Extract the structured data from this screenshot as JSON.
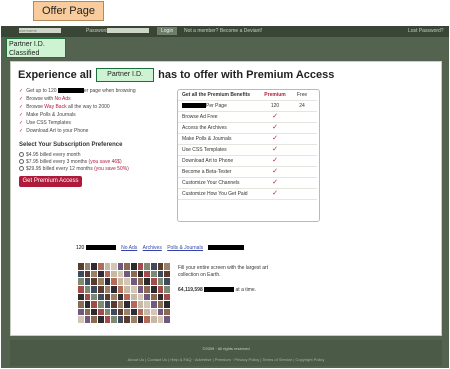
{
  "labels": {
    "offer": "Offer Page",
    "partner_classified": "Partner I.D. Classified",
    "partner_inline": "Partner I.D."
  },
  "topbar": {
    "username_placeholder": "username",
    "password_label": "Password",
    "login_button": "Login",
    "member_prompt": "Not a member? Become a Deviant!",
    "lost_password": "Lost Password?"
  },
  "headline": {
    "prefix": "Experience all",
    "suffix": "has to offer with Premium Access"
  },
  "features": [
    {
      "pre": "Get up to 120 ",
      "redact": true,
      "post": "er page when browsing"
    },
    {
      "pre": "Browse with ",
      "hl": "No Ads",
      "post": ""
    },
    {
      "pre": "Browse ",
      "hl": "Way Back",
      "post": " all the way to 2000"
    },
    {
      "pre": "Make Polls & Journals",
      "hl": "",
      "post": ""
    },
    {
      "pre": "Use CSS Templates",
      "hl": "",
      "post": ""
    },
    {
      "pre": "Download Art to your Phone",
      "hl": "",
      "post": ""
    }
  ],
  "subscription": {
    "title": "Select Your Subscription Preference",
    "options": [
      {
        "text": "$4.95 billed every month",
        "save": ""
      },
      {
        "text": "$7.95 billed every 3 months ",
        "save": "(you save 46$)"
      },
      {
        "text": "$29.95 billed every 12 months ",
        "save": "(you save 50%)"
      }
    ],
    "button": "Get Premium Access"
  },
  "benefits": {
    "header": {
      "name": "Get all the Premium Benefits",
      "premium": "Premium",
      "free": "Free"
    },
    "per_page": {
      "name": "Per Page",
      "premium": "120",
      "free": "24"
    },
    "rows": [
      "Browse Ad Free",
      "Access the Archives",
      "Make Polls & Journals",
      "Use CSS Templates",
      "Download Art to Phone",
      "Become a Beta-Tester",
      "Customize Your Channels",
      "Customize How You Get Paid"
    ]
  },
  "stats": {
    "count": "120",
    "links": [
      "No Ads",
      "Archives",
      "Polls & Journals"
    ]
  },
  "promo": {
    "fill": "Fill your entire screen with the largest art collection on Earth.",
    "count": "64,119,598",
    "suffix": "at a time."
  },
  "footer": {
    "copyright": "©2009 · All rights reserved",
    "links": "About Us | Contact Us | Help & FAQ · Advertise | Premium · Privacy Policy | Terms of Service | Copyright Policy"
  },
  "colors": {
    "accent": "#b01a3a",
    "frame": "#53634f",
    "tag_offer": "#f9cc9d",
    "tag_partner": "#cdf3d3"
  }
}
